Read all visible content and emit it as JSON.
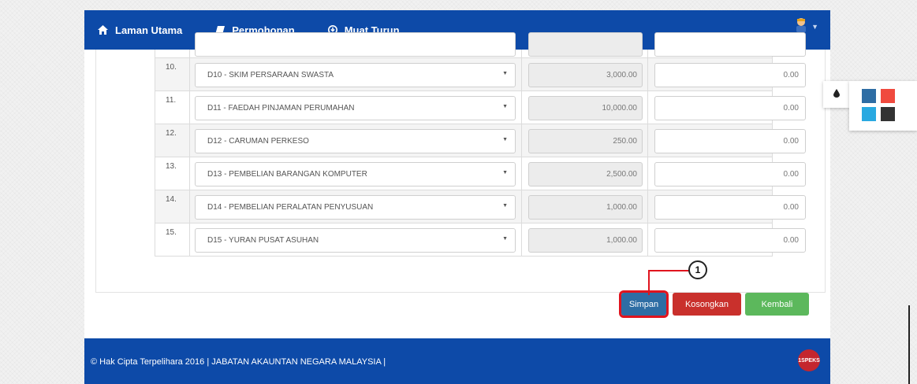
{
  "nav": {
    "items": [
      {
        "label": "Laman Utama",
        "icon": "home-icon"
      },
      {
        "label": "Permohonan",
        "icon": "book-icon"
      },
      {
        "label": "Muat Turun",
        "icon": "download-icon"
      }
    ],
    "user_icon": "user-avatar-icon"
  },
  "table": {
    "rows": [
      {
        "no": "10.",
        "item": "D10 - SKIM PERSARAAN SWASTA",
        "limit": "3,000.00",
        "value": "0.00"
      },
      {
        "no": "11.",
        "item": "D11 - FAEDAH PINJAMAN PERUMAHAN",
        "limit": "10,000.00",
        "value": "0.00"
      },
      {
        "no": "12.",
        "item": "D12 - CARUMAN PERKESO",
        "limit": "250.00",
        "value": "0.00"
      },
      {
        "no": "13.",
        "item": "D13 - PEMBELIAN BARANGAN KOMPUTER",
        "limit": "2,500.00",
        "value": "0.00"
      },
      {
        "no": "14.",
        "item": "D14 - PEMBELIAN PERALATAN PENYUSUAN",
        "limit": "1,000.00",
        "value": "0.00"
      },
      {
        "no": "15.",
        "item": "D15 - YURAN PUSAT ASUHAN",
        "limit": "1,000.00",
        "value": "0.00"
      }
    ]
  },
  "buttons": {
    "save": "Simpan",
    "clear": "Kosongkan",
    "back": "Kembali"
  },
  "callout": {
    "number": "1"
  },
  "footer": {
    "copyright": "© Hak Cipta Terpelihara 2016 | JABATAN AKAUNTAN NEGARA MALAYSIA |",
    "logo_text": "1SPEKS"
  },
  "theme": {
    "icon": "paint-drop-icon",
    "swatches": [
      "#2e6da4",
      "#f04a3e",
      "#29a9e1",
      "#333333"
    ]
  },
  "colors": {
    "brand": "#0d4aa8",
    "save": "#2e6da4",
    "clear": "#c9302c",
    "back": "#5cb85c",
    "callout": "#e0141e"
  }
}
